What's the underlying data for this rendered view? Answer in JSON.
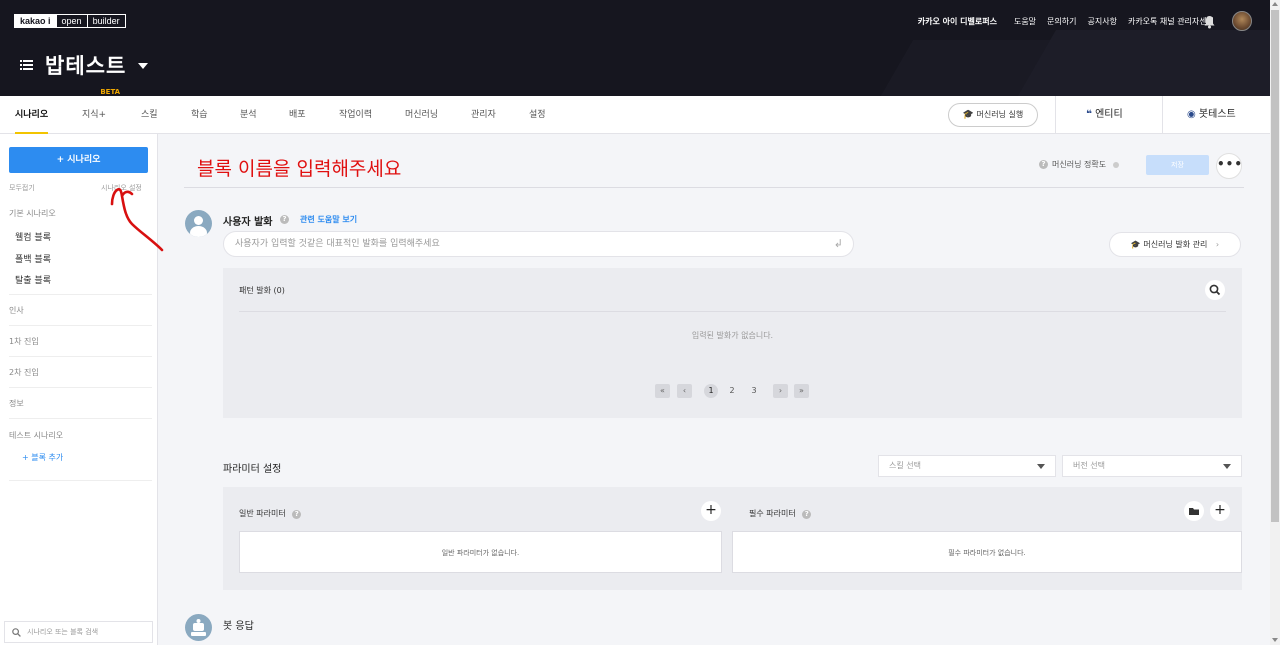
{
  "header": {
    "logo": [
      "kakao i",
      "open",
      "builder"
    ],
    "nav": [
      "카카오 아이 디벨로퍼스",
      "도움말",
      "문의하기",
      "공지사항",
      "카카오톡 채널 관리자센터"
    ],
    "bot_name": "밥테스트"
  },
  "tabs": {
    "items": [
      "시나리오",
      "지식+",
      "스킬",
      "학습",
      "분석",
      "배포",
      "작업이력",
      "머신러닝",
      "관리자",
      "설정"
    ],
    "beta": "BETA",
    "ml_run": "머신러닝 실행",
    "entity": "엔티티",
    "bot_test": "봇테스트"
  },
  "sidebar": {
    "add_scenario": "+ 시나리오",
    "collapse_all": "모두접기",
    "scenario_settings": "시나리오 설정",
    "sections": [
      {
        "title": "기본 시나리오",
        "items": [
          "웰컴 블록",
          "폴백 블록",
          "탈출 블록"
        ]
      },
      {
        "title": "인사",
        "items": []
      },
      {
        "title": "1차 진입",
        "items": []
      },
      {
        "title": "2차 진입",
        "items": []
      },
      {
        "title": "정보",
        "items": []
      },
      {
        "title": "테스트 시나리오",
        "items": []
      }
    ],
    "add_block": "+ 블록 추가",
    "search_placeholder": "시나리오 또는 블록 검색"
  },
  "main": {
    "block_title_placeholder": "블록 이름을 입력해주세요",
    "ml_accuracy": "머신러닝 정확도",
    "save": "저장",
    "more": "•••",
    "user_utterance": {
      "title": "사용자 발화",
      "help_link": "관련 도움말 보기",
      "placeholder": "사용자가 입력할 것같은 대표적인 발화를 입력해주세요",
      "ml_manage": "머신러닝 발화 관리",
      "pattern_title": "패턴 발화 (0)",
      "empty": "입력된 발화가 없습니다.",
      "pages": [
        "1",
        "2",
        "3"
      ],
      "current_page": 1
    },
    "params": {
      "title": "파라미터 설정",
      "skill_select": "스킬 선택",
      "version_select": "버전 선택",
      "general_title": "일반 파라미터",
      "general_empty": "일반 파라미터가 없습니다.",
      "required_title": "필수 파라미터",
      "required_empty": "필수 파라미터가 없습니다."
    },
    "bot_response": {
      "title": "봇 응답"
    }
  },
  "colors": {
    "accent": "#2d8cf0",
    "header_bg": "#16161f",
    "tab_active": "#f2c400",
    "annotation": "#e01010"
  }
}
